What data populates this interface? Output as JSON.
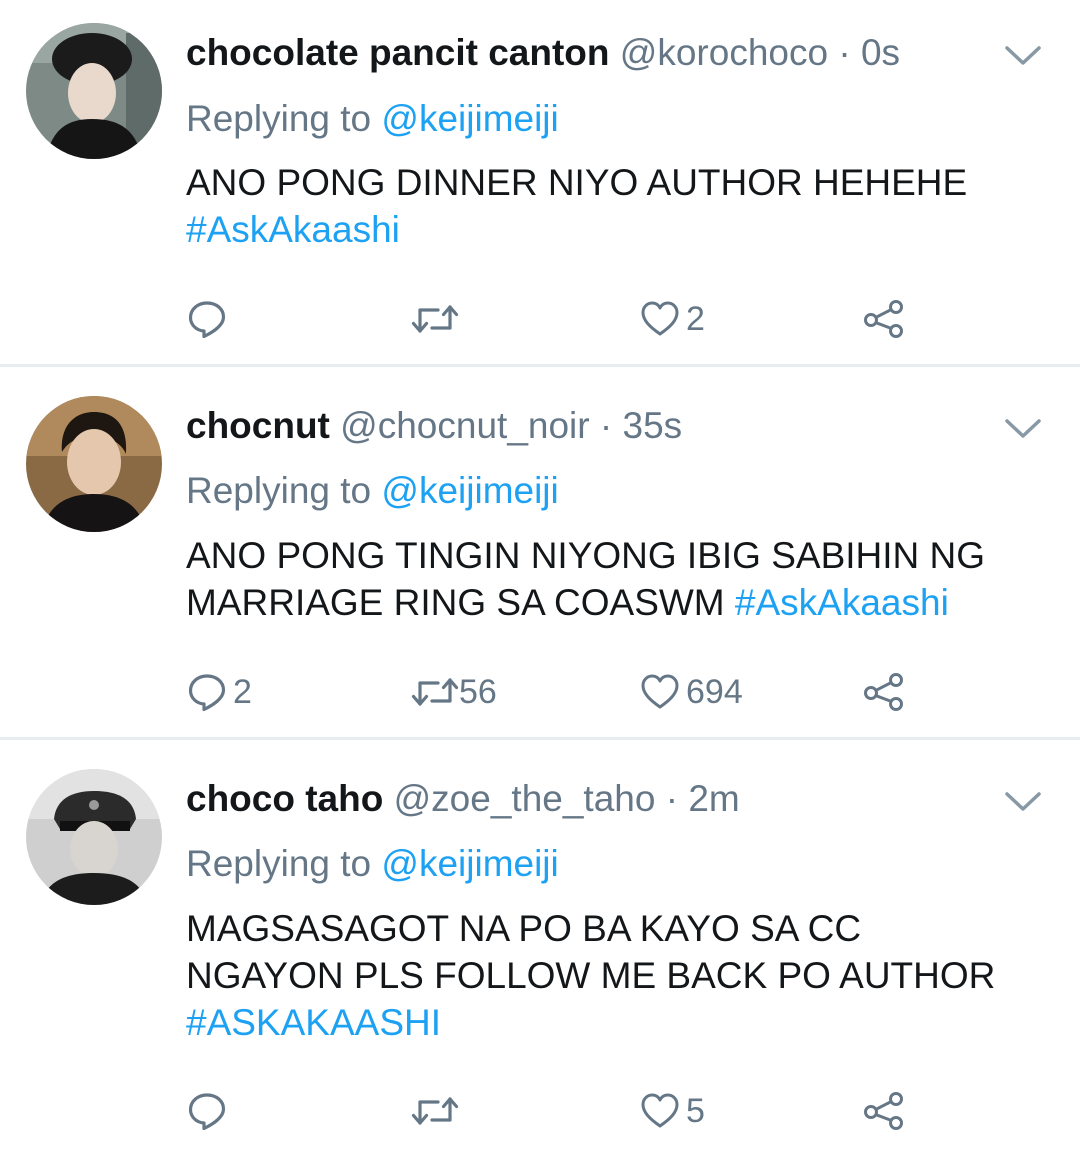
{
  "colors": {
    "accent": "#1da1f2",
    "muted": "#657786",
    "text": "#14171a",
    "divider": "#e6ecf0"
  },
  "tweets": [
    {
      "name": "chocolate pancit canton",
      "handle": "@korochoco",
      "separator": "·",
      "time": "0s",
      "replying_prefix": "Replying to",
      "replying_to": "@keijimeiji",
      "text": "ANO PONG DINNER NIYO AUTHOR HEHEHE",
      "hashtag": "#AskAkaashi",
      "counts": {
        "replies": "",
        "retweets": "",
        "likes": "2"
      },
      "icons": [
        "reply-icon",
        "retweet-icon",
        "heart-icon",
        "share-icon",
        "chevron-down-icon"
      ]
    },
    {
      "name": "chocnut",
      "handle": "@chocnut_noir",
      "separator": "·",
      "time": "35s",
      "replying_prefix": "Replying to",
      "replying_to": "@keijimeiji",
      "text_line1": "ANO PONG TINGIN NIYONG IBIG SABIHIN NG",
      "text_line2": "MARRIAGE RING SA COASWM",
      "hashtag": "#AskAkaashi",
      "counts": {
        "replies": "2",
        "retweets": "56",
        "likes": "694"
      },
      "icons": [
        "reply-icon",
        "retweet-icon",
        "heart-icon",
        "share-icon",
        "chevron-down-icon"
      ]
    },
    {
      "name": "choco taho",
      "handle": "@zoe_the_taho",
      "separator": "·",
      "time": "2m",
      "replying_prefix": "Replying to",
      "replying_to": "@keijimeiji",
      "text_line1": "MAGSASAGOT NA PO BA KAYO SA CC",
      "text_line2": "NGAYON PLS FOLLOW ME BACK PO AUTHOR",
      "hashtag": "#ASKAKAASHI",
      "counts": {
        "replies": "",
        "retweets": "",
        "likes": "5"
      },
      "icons": [
        "reply-icon",
        "retweet-icon",
        "heart-icon",
        "share-icon",
        "chevron-down-icon"
      ]
    }
  ]
}
